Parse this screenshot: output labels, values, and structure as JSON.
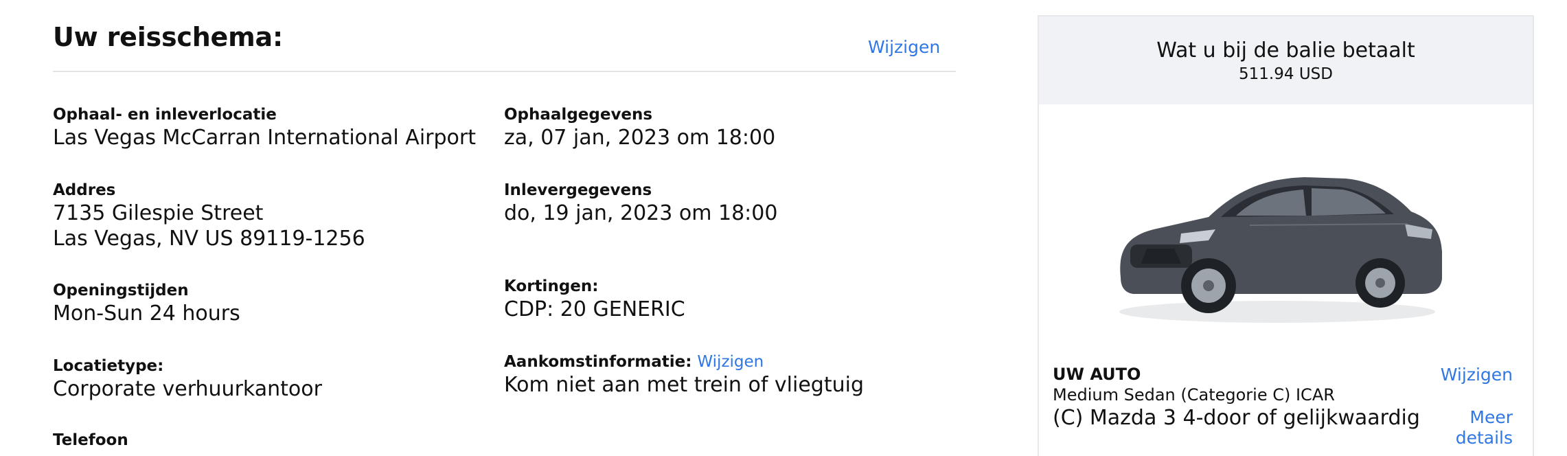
{
  "itinerary": {
    "title": "Uw reisschema:",
    "change_label": "Wijzigen",
    "left": [
      {
        "label": "Ophaal- en inleverlocatie",
        "lines": [
          "Las Vegas McCarran International Airport"
        ]
      },
      {
        "label": "Addres",
        "lines": [
          "7135 Gilespie Street",
          "Las Vegas, NV US 89119-1256"
        ]
      },
      {
        "label": "Openingstijden",
        "lines": [
          "Mon-Sun 24 hours"
        ]
      },
      {
        "label": "Locatietype:",
        "lines": [
          "Corporate verhuurkantoor"
        ]
      },
      {
        "label": "Telefoon"
      }
    ],
    "right": [
      {
        "label": "Ophaalgegevens",
        "lines": [
          "za, 07 jan, 2023 om 18:00"
        ]
      },
      {
        "label": "Inlevergegevens",
        "lines": [
          "do, 19 jan, 2023 om 18:00"
        ]
      },
      {
        "label": "Kortingen:",
        "lines": [
          "CDP: 20 GENERIC"
        ]
      },
      {
        "label": "Aankomstinformatie:",
        "link": "Wijzigen",
        "lines": [
          "Kom niet aan met trein of vliegtuig"
        ]
      }
    ]
  },
  "summary": {
    "heading": "Wat u bij de balie betaalt",
    "amount": "511.94 USD",
    "car": {
      "section_title": "UW AUTO",
      "change_label": "Wijzigen",
      "category": "Medium Sedan (Categorie C) ICAR",
      "model": "(C) Mazda 3 4-door of gelijkwaardig",
      "more_details": "Meer details"
    }
  },
  "colors": {
    "link": "#2f77e5",
    "card_header_bg": "#f0f2f5",
    "car_body": "#4b5058"
  }
}
